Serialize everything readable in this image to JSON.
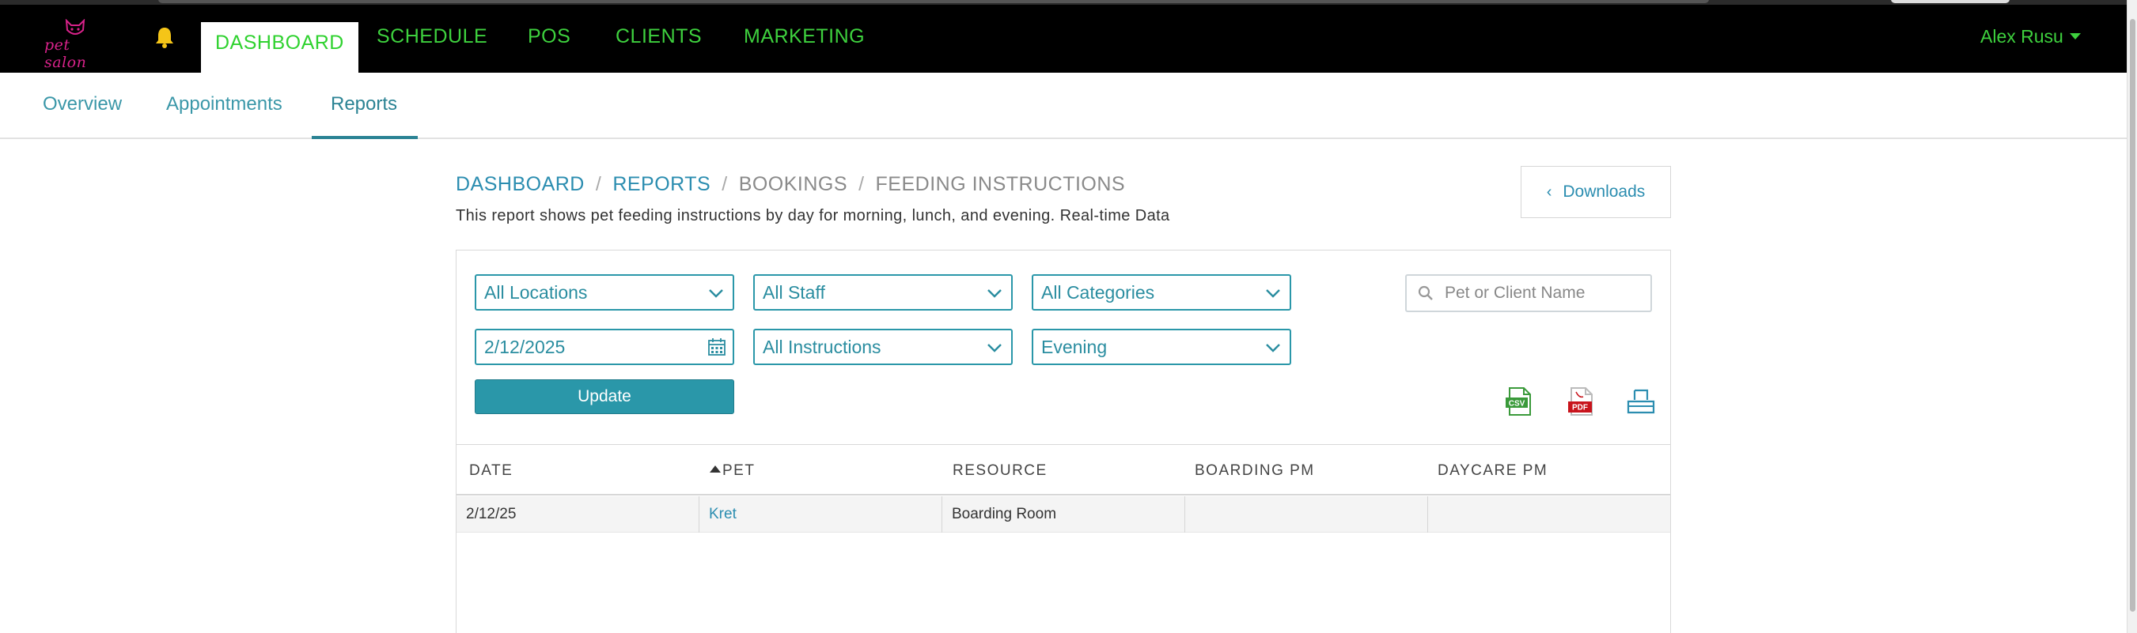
{
  "app": {
    "logo_text": "pet salon"
  },
  "nav": {
    "items": [
      {
        "label": "DASHBOARD",
        "active": true
      },
      {
        "label": "SCHEDULE",
        "active": false
      },
      {
        "label": "POS",
        "active": false
      },
      {
        "label": "CLIENTS",
        "active": false
      },
      {
        "label": "MARKETING",
        "active": false
      }
    ],
    "user": "Alex Rusu"
  },
  "subtabs": [
    {
      "label": "Overview",
      "active": false
    },
    {
      "label": "Appointments",
      "active": false
    },
    {
      "label": "Reports",
      "active": true
    }
  ],
  "breadcrumb": {
    "items": [
      "DASHBOARD",
      "REPORTS",
      "BOOKINGS",
      "FEEDING INSTRUCTIONS"
    ],
    "separator": "/"
  },
  "description": "This report shows pet feeding instructions by day for morning, lunch, and evening. Real-time Data",
  "downloads_label": "Downloads",
  "filters": {
    "location": "All Locations",
    "staff": "All Staff",
    "category": "All Categories",
    "date": "2/12/2025",
    "instructions": "All Instructions",
    "time_of_day": "Evening",
    "search_placeholder": "Pet or Client Name"
  },
  "update_label": "Update",
  "exports": {
    "csv_label": "CSV",
    "pdf_label": "PDF"
  },
  "table": {
    "columns": [
      "DATE",
      "PET",
      "RESOURCE",
      "BOARDING PM",
      "DAYCARE PM"
    ],
    "sorted_column": "PET",
    "rows": [
      {
        "date": "2/12/25",
        "pet": "Kret",
        "resource": "Boarding Room",
        "boarding_pm": "",
        "daycare_pm": ""
      }
    ]
  },
  "colors": {
    "nav_bg": "#000000",
    "nav_text": "#3ed13e",
    "accent": "#2a97a9",
    "link": "#2b8db0"
  }
}
